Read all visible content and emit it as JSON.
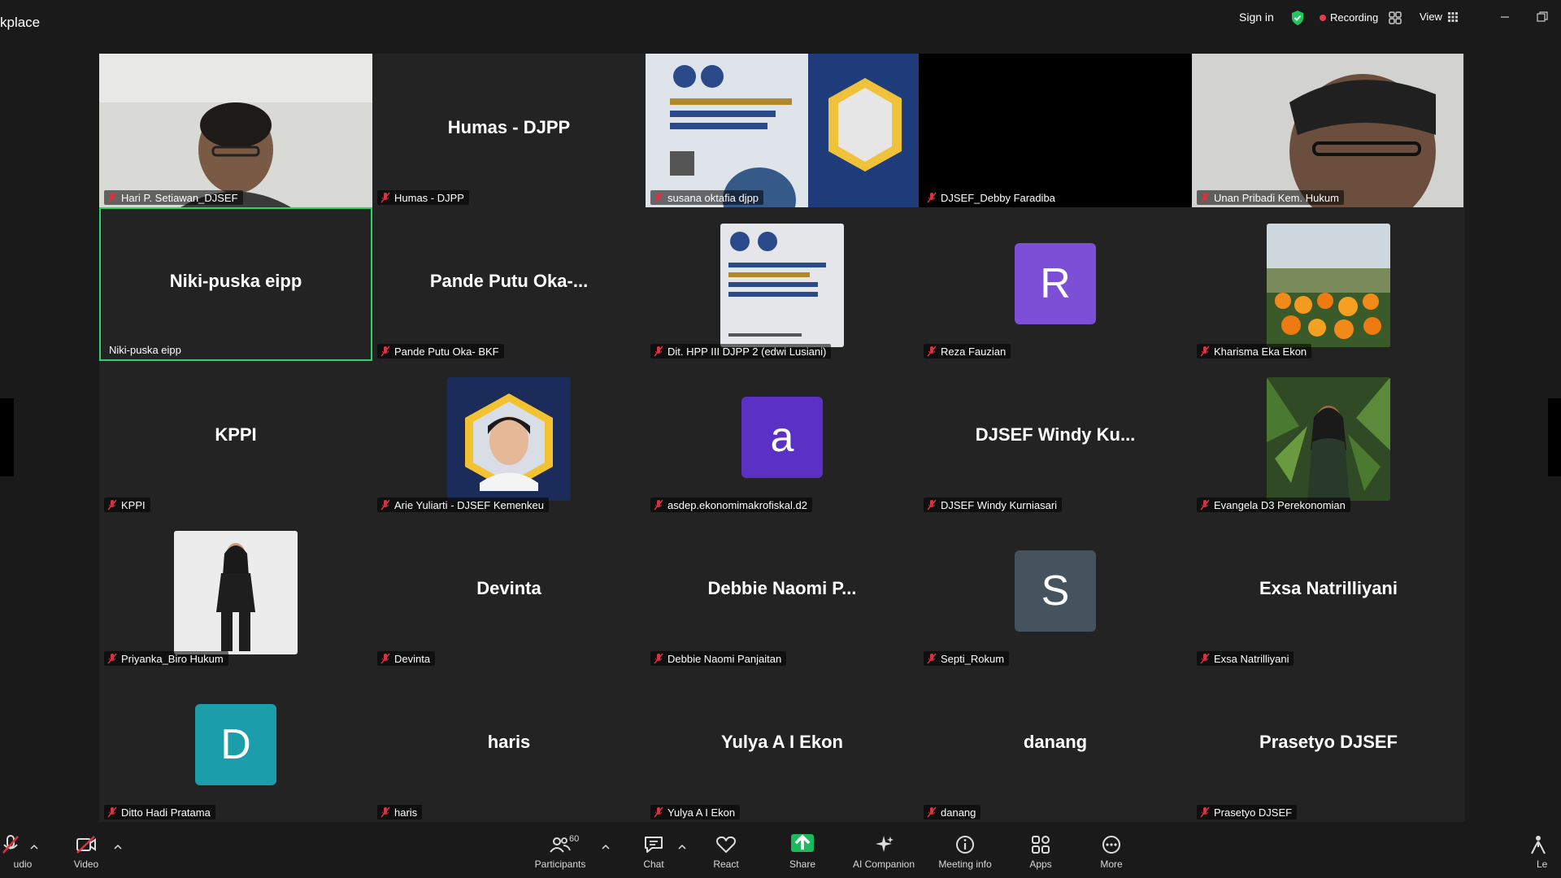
{
  "window": {
    "title": "kplace",
    "sign_in": "Sign in",
    "recording": "Recording",
    "view": "View"
  },
  "tiles": [
    {
      "center": "",
      "label": "Hari P. Setiawan_DJSEF",
      "kind": "video"
    },
    {
      "center": "Humas - DJPP",
      "label": "Humas - DJPP",
      "kind": "name"
    },
    {
      "center": "",
      "label": "susana oktafia djpp",
      "kind": "video"
    },
    {
      "center": "",
      "label": "DJSEF_Debby Faradiba",
      "kind": "black"
    },
    {
      "center": "",
      "label": "Unan Pribadi Kem. Hukum",
      "kind": "video"
    },
    {
      "center": "Niki-puska eipp",
      "label": "Niki-puska eipp",
      "kind": "name"
    },
    {
      "center": "Pande Putu Oka-...",
      "label": "Pande Putu Oka- BKF",
      "kind": "name"
    },
    {
      "center": "",
      "label": "Dit. HPP III DJPP 2 (edwi Lusiani)",
      "kind": "pic"
    },
    {
      "center": "R",
      "label": "Reza Fauzian",
      "kind": "letter"
    },
    {
      "center": "",
      "label": "Kharisma Eka Ekon",
      "kind": "pic"
    },
    {
      "center": "KPPI",
      "label": "KPPI",
      "kind": "name"
    },
    {
      "center": "",
      "label": "Arie Yuliarti - DJSEF Kemenkeu",
      "kind": "pic"
    },
    {
      "center": "a",
      "label": "asdep.ekonomimakrofiskal.d2",
      "kind": "letter"
    },
    {
      "center": "DJSEF Windy Ku...",
      "label": "DJSEF Windy Kurniasari",
      "kind": "name"
    },
    {
      "center": "",
      "label": "Evangela D3 Perekonomian",
      "kind": "pic"
    },
    {
      "center": "",
      "label": "Priyanka_Biro Hukum",
      "kind": "pic"
    },
    {
      "center": "Devinta",
      "label": "Devinta",
      "kind": "name"
    },
    {
      "center": "Debbie Naomi P...",
      "label": "Debbie Naomi Panjaitan",
      "kind": "name"
    },
    {
      "center": "S",
      "label": "Septi_Rokum",
      "kind": "letter"
    },
    {
      "center": "Exsa Natrilliyani",
      "label": "Exsa Natrilliyani",
      "kind": "name"
    },
    {
      "center": "D",
      "label": "Ditto Hadi Pratama",
      "kind": "letter"
    },
    {
      "center": "haris",
      "label": "haris",
      "kind": "name"
    },
    {
      "center": "Yulya A I Ekon",
      "label": "Yulya A I Ekon",
      "kind": "name"
    },
    {
      "center": "danang",
      "label": "danang",
      "kind": "name"
    },
    {
      "center": "Prasetyo DJSEF",
      "label": "Prasetyo DJSEF",
      "kind": "name"
    }
  ],
  "toolbar": {
    "audio": "udio",
    "video": "Video",
    "participants": "Participants",
    "participants_count": "60",
    "chat": "Chat",
    "react": "React",
    "share": "Share",
    "ai_companion": "AI Companion",
    "meeting_info": "Meeting info",
    "apps": "Apps",
    "more": "More",
    "leave": "Le"
  },
  "colors": {
    "active_speaker": "#2dd36f",
    "recording_dot": "#e8394d",
    "share_green": "#19b95c",
    "avatar_r": "#7d4fd6",
    "avatar_a": "#5a31c4",
    "avatar_s": "#45535f",
    "avatar_d": "#1b9eaa"
  }
}
